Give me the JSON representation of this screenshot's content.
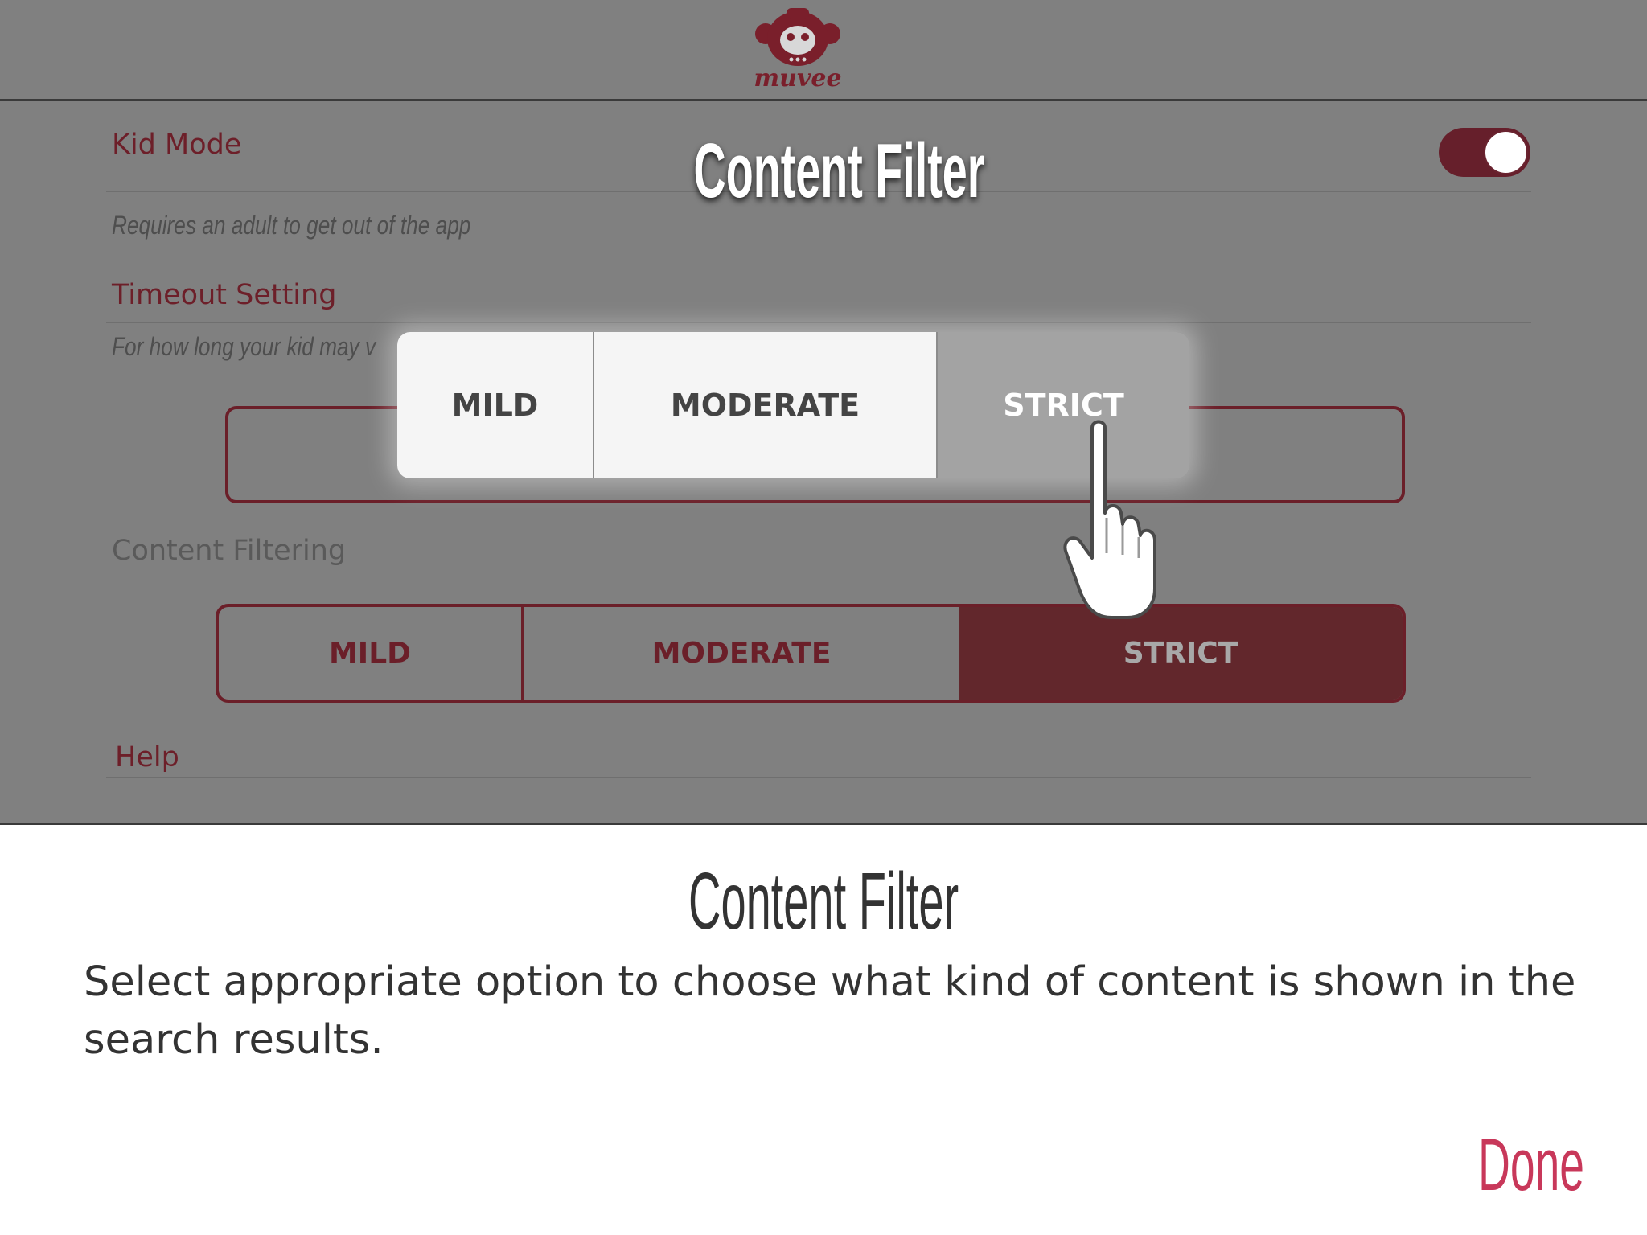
{
  "app": {
    "logo_text": "muvee",
    "kid_mode_label": "Kid Mode",
    "kid_mode_on": true,
    "kid_mode_description": "Requires an adult to get out of the app",
    "timeout_label": "Timeout Setting",
    "timeout_description": "For how long your kid may v",
    "content_filtering_label": "Content Filtering",
    "content_filter_options": [
      "MILD",
      "MODERATE",
      "STRICT"
    ],
    "content_filter_selected": "STRICT",
    "help_label": "Help"
  },
  "overlay": {
    "title": "Content Filter",
    "options": [
      "MILD",
      "MODERATE",
      "STRICT"
    ],
    "highlighted": "STRICT"
  },
  "info": {
    "title": "Content Filter",
    "body": "Select appropriate option to choose what kind of content is shown in the search results.",
    "done_label": "Done"
  },
  "colors": {
    "brand": "#6b1f29",
    "dim_background": "#808080",
    "done": "#c8385a"
  },
  "icons": {
    "logo": "monkey-logo-icon",
    "cursor": "pointing-hand-icon"
  }
}
